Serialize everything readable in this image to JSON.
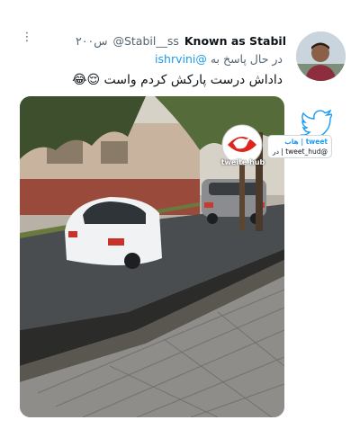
{
  "tweet": {
    "author_name": "Known as Stabil",
    "author_handle": "@Stabil__ss",
    "timestamp": "۲۰۰س",
    "reply_prefix": "در حال پاسخ به",
    "reply_to": "@ishrvini",
    "text": "داداش درست پارکش کردم واست 😌😂"
  },
  "watermark": {
    "logo_text": "tweite hub",
    "badge_line1": "tweet | هاب",
    "badge_line2": "@tweet_hud | در اینتا"
  },
  "colors": {
    "link": "#1d9bf0",
    "secondary_text": "#536471",
    "primary_text": "#0f1419",
    "brand_red": "#e0241c"
  },
  "icons": {
    "more": "vertical-ellipsis-icon",
    "watermark_bird": "twitter-bird-icon"
  }
}
